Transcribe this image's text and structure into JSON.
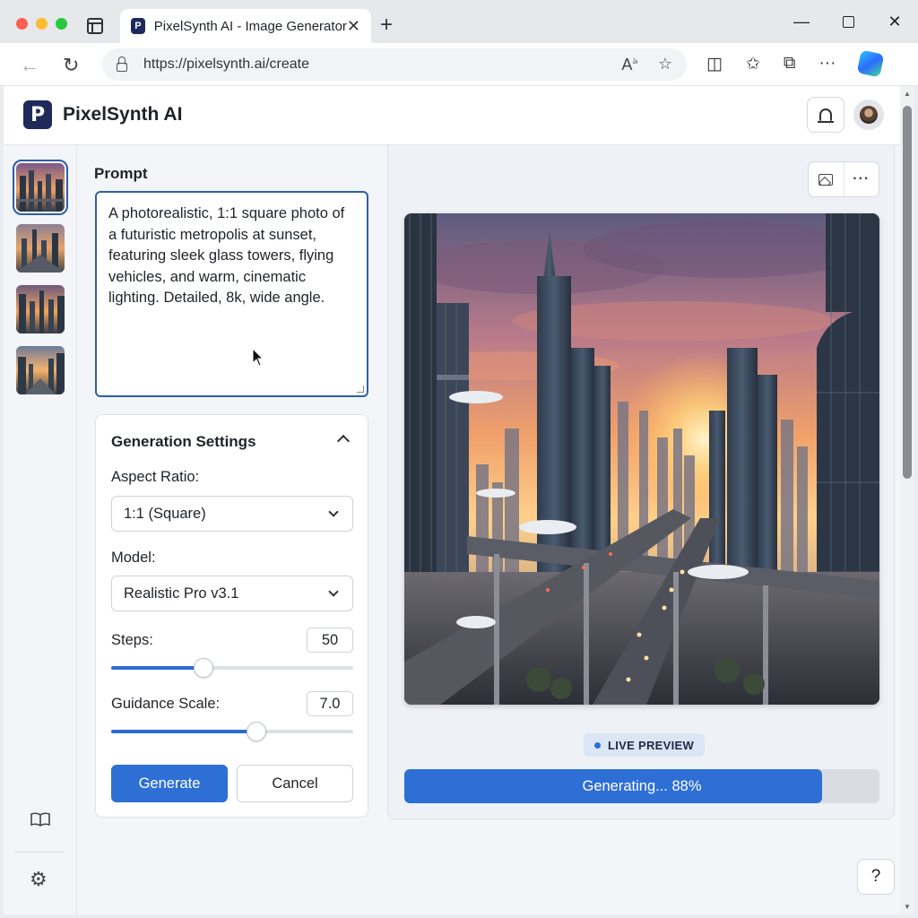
{
  "browser": {
    "tab_title": "PixelSynth AI - Image Generator",
    "favicon_letter": "P",
    "url": "https://pixelsynth.ai/create",
    "icons": [
      "tab-list-icon",
      "close-icon",
      "new-tab-icon",
      "minimize-icon",
      "maximize-icon",
      "close-window-icon",
      "back-icon",
      "refresh-icon",
      "lock-icon",
      "read-aloud-icon",
      "star-icon",
      "split-screen-icon",
      "favorites-icon",
      "collections-icon",
      "more-icon",
      "copilot-icon"
    ]
  },
  "app": {
    "name": "PixelSynth AI",
    "logo_letter": "P",
    "brand_color": "#1f2a5a",
    "accent_color": "#2e6fd6"
  },
  "thumbnails": [
    {
      "name": "history-thumb-1",
      "active": true
    },
    {
      "name": "history-thumb-2",
      "active": false
    },
    {
      "name": "history-thumb-3",
      "active": false
    },
    {
      "name": "history-thumb-4",
      "active": false
    }
  ],
  "prompt": {
    "label": "Prompt",
    "value": "A photorealistic, 1:1 square photo of a futuristic metropolis at sunset, featuring sleek glass towers, flying vehicles, and warm, cinematic lighting. Detailed, 8k, wide angle."
  },
  "settings": {
    "title": "Generation Settings",
    "aspect_label": "Aspect Ratio:",
    "aspect_value": "1:1 (Square)",
    "model_label": "Model:",
    "model_value": "Realistic Pro v3.1",
    "steps_label": "Steps:",
    "steps_value": "50",
    "steps_fraction": 0.38,
    "guidance_label": "Guidance Scale:",
    "guidance_value": "7.0",
    "guidance_fraction": 0.6,
    "generate_label": "Generate",
    "cancel_label": "Cancel"
  },
  "preview": {
    "badge": "LIVE PREVIEW",
    "progress_label": "Generating... 88%",
    "progress_percent": 88
  },
  "help": {
    "label": "?"
  }
}
